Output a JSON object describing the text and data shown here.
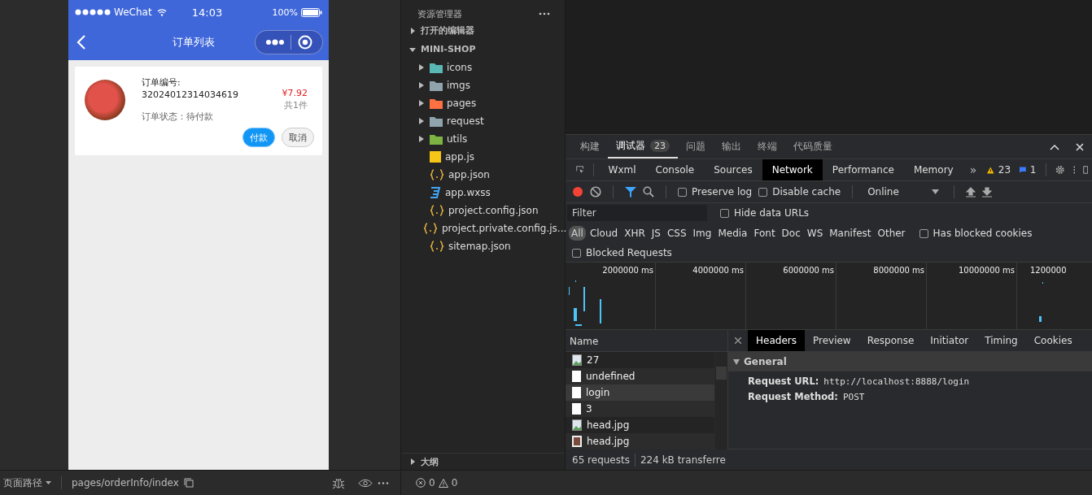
{
  "simulator": {
    "status_bar": {
      "carrier": "WeChat",
      "time": "14:03",
      "battery": "100%"
    },
    "nav": {
      "title": "订单列表"
    },
    "orders": [
      {
        "number_label": "订单编号:",
        "number": "32024012314034619",
        "status": "订单状态：待付款",
        "price": "¥7.92",
        "count": "共1件",
        "actions": [
          {
            "label": "付款",
            "kind": "primary"
          },
          {
            "label": "取消",
            "kind": "secondary"
          }
        ]
      }
    ]
  },
  "simulator_footer": {
    "path_label": "页面路径",
    "path": "pages/orderInfo/index"
  },
  "explorer": {
    "title": "资源管理器",
    "sections": [
      {
        "label": "打开的编辑器",
        "expanded": false
      },
      {
        "label": "MINI-SHOP",
        "expanded": true
      }
    ],
    "files": [
      {
        "name": "icons",
        "kind": "folder",
        "color": "#5ab8b4"
      },
      {
        "name": "imgs",
        "kind": "folder",
        "color": "#90a4ae"
      },
      {
        "name": "pages",
        "kind": "folder",
        "color": "#ff7043"
      },
      {
        "name": "request",
        "kind": "folder",
        "color": "#90a4ae"
      },
      {
        "name": "utils",
        "kind": "folder",
        "color": "#7cb342"
      },
      {
        "name": "app.js",
        "kind": "js"
      },
      {
        "name": "app.json",
        "kind": "json"
      },
      {
        "name": "app.wxss",
        "kind": "css"
      },
      {
        "name": "project.config.json",
        "kind": "json"
      },
      {
        "name": "project.private.config.js...",
        "kind": "json"
      },
      {
        "name": "sitemap.json",
        "kind": "json"
      }
    ],
    "outline": {
      "label": "大纲",
      "expanded": false
    },
    "problems": {
      "errors": "0",
      "warnings": "0"
    }
  },
  "devtools": {
    "panel_tabs": [
      {
        "label": "构建",
        "selected": false
      },
      {
        "label": "调试器",
        "selected": true,
        "badge": "23"
      },
      {
        "label": "问题",
        "selected": false
      },
      {
        "label": "输出",
        "selected": false
      },
      {
        "label": "终端",
        "selected": false
      },
      {
        "label": "代码质量",
        "selected": false
      }
    ],
    "tool_tabs": [
      {
        "label": "Wxml",
        "selected": false
      },
      {
        "label": "Console",
        "selected": false
      },
      {
        "label": "Sources",
        "selected": false
      },
      {
        "label": "Network",
        "selected": true
      },
      {
        "label": "Performance",
        "selected": false
      },
      {
        "label": "Memory",
        "selected": false
      }
    ],
    "more": "»",
    "warnings": "23",
    "messages": "1",
    "toolbar": {
      "recording": true,
      "options": [
        {
          "label": "Preserve log",
          "checked": false
        },
        {
          "label": "Disable cache",
          "checked": false
        }
      ],
      "throttle": "Online"
    },
    "filter": {
      "placeholder": "Filter",
      "option": {
        "label": "Hide data URLs",
        "checked": false
      }
    },
    "type_filters": [
      {
        "label": "All",
        "selected": true
      },
      {
        "label": "Cloud",
        "selected": false
      },
      {
        "label": "XHR",
        "selected": false
      },
      {
        "label": "JS",
        "selected": false
      },
      {
        "label": "CSS",
        "selected": false
      },
      {
        "label": "Img",
        "selected": false
      },
      {
        "label": "Media",
        "selected": false
      },
      {
        "label": "Font",
        "selected": false
      },
      {
        "label": "Doc",
        "selected": false
      },
      {
        "label": "WS",
        "selected": false
      },
      {
        "label": "Manifest",
        "selected": false
      },
      {
        "label": "Other",
        "selected": false
      }
    ],
    "blocked_cookies": {
      "label": "Has blocked cookies",
      "checked": false
    },
    "blocked_requests": {
      "label": "Blocked Requests",
      "checked": false
    },
    "timeline": {
      "ticks": [
        "2000000 ms",
        "4000000 ms",
        "6000000 ms",
        "8000000 ms",
        "10000000 ms",
        "1200000"
      ]
    },
    "requests": {
      "column": "Name",
      "rows": [
        {
          "name": "27",
          "kind": "image",
          "selected": false
        },
        {
          "name": "undefined",
          "kind": "document",
          "selected": false
        },
        {
          "name": "login",
          "kind": "document",
          "selected": true
        },
        {
          "name": "3",
          "kind": "document",
          "selected": false
        },
        {
          "name": "head.jpg",
          "kind": "image",
          "selected": false
        },
        {
          "name": "head.jpg",
          "kind": "photo",
          "selected": false
        }
      ],
      "summary": [
        "65 requests",
        "224 kB transferre"
      ]
    },
    "details": {
      "tabs": [
        {
          "label": "Headers",
          "selected": true
        },
        {
          "label": "Preview",
          "selected": false
        },
        {
          "label": "Response",
          "selected": false
        },
        {
          "label": "Initiator",
          "selected": false
        },
        {
          "label": "Timing",
          "selected": false
        },
        {
          "label": "Cookies",
          "selected": false
        }
      ],
      "section": {
        "label": "General",
        "expanded": true
      },
      "fields": [
        {
          "name": "Request URL:",
          "value": "http://localhost:8888/login"
        },
        {
          "name": "Request Method:",
          "value": "POST"
        }
      ]
    }
  }
}
